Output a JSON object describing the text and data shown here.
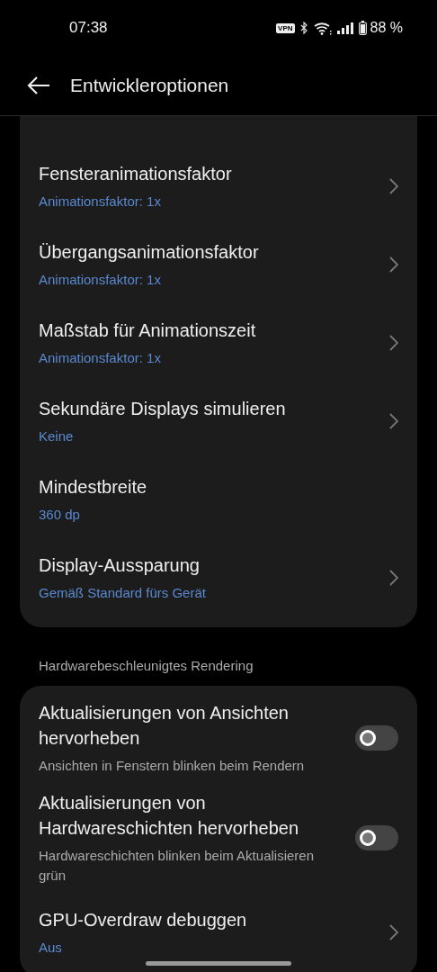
{
  "status_bar": {
    "time": "07:38",
    "vpn": "VPN",
    "battery": "88 %"
  },
  "app_bar": {
    "title": "Entwickleroptionen"
  },
  "sections": [
    {
      "items": [
        {
          "kind": "chevron",
          "title": "Fensteranimationsfaktor",
          "subtitle": "Animationsfaktor: 1x"
        },
        {
          "kind": "chevron",
          "title": "Übergangsanimationsfaktor",
          "subtitle": "Animationsfaktor: 1x"
        },
        {
          "kind": "chevron",
          "title": "Maßstab für Animationszeit",
          "subtitle": "Animationsfaktor: 1x"
        },
        {
          "kind": "chevron",
          "title": "Sekundäre Displays simulieren",
          "subtitle": "Keine"
        },
        {
          "kind": "plain",
          "title": "Mindestbreite",
          "subtitle": "360 dp"
        },
        {
          "kind": "chevron",
          "title": "Display-Aussparung",
          "subtitle": "Gemäß Standard fürs Gerät"
        }
      ]
    },
    {
      "header": "Hardwarebeschleunigtes Rendering",
      "items": [
        {
          "kind": "toggle",
          "title": "Aktualisierungen von Ansichten hervorheben",
          "subtitle": "Ansichten in Fenstern blinken beim Rendern",
          "on": false
        },
        {
          "kind": "toggle",
          "title": "Aktualisierungen von Hardwareschichten hervorheben",
          "subtitle": "Hardwareschichten blinken beim Aktualisieren grün",
          "on": false
        },
        {
          "kind": "chevron",
          "title": "GPU-Overdraw debuggen",
          "subtitle": "Aus"
        }
      ]
    }
  ]
}
